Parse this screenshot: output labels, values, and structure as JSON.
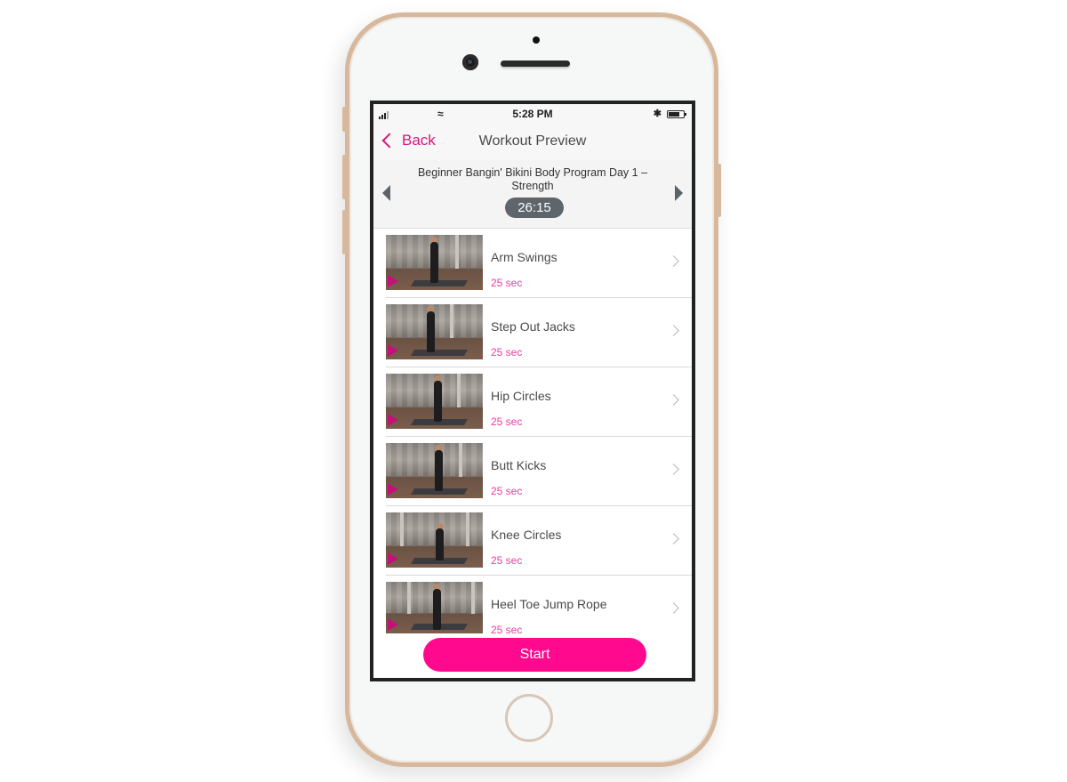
{
  "status_bar": {
    "time": "5:28 PM",
    "wifi_icon": "wifi-icon",
    "bluetooth_icon": "bluetooth-icon",
    "battery_icon": "battery-icon",
    "signal_icon": "signal-icon"
  },
  "nav": {
    "back_label": "Back",
    "title": "Workout Preview"
  },
  "program": {
    "title": "Beginner Bangin' Bikini Body Program Day 1 – Strength",
    "duration": "26:15"
  },
  "exercises": [
    {
      "name": "Arm Swings",
      "duration": "25 sec"
    },
    {
      "name": "Step Out Jacks",
      "duration": "25 sec"
    },
    {
      "name": "Hip Circles",
      "duration": "25 sec"
    },
    {
      "name": "Butt Kicks",
      "duration": "25 sec"
    },
    {
      "name": "Knee Circles",
      "duration": "25 sec"
    },
    {
      "name": "Heel Toe Jump Rope",
      "duration": "25 sec"
    }
  ],
  "start_label": "Start",
  "colors": {
    "accent": "#d1177e",
    "start_button": "#ff0a8e",
    "duration_text": "#f03aa0",
    "phone_frame": "#d7b89c"
  }
}
